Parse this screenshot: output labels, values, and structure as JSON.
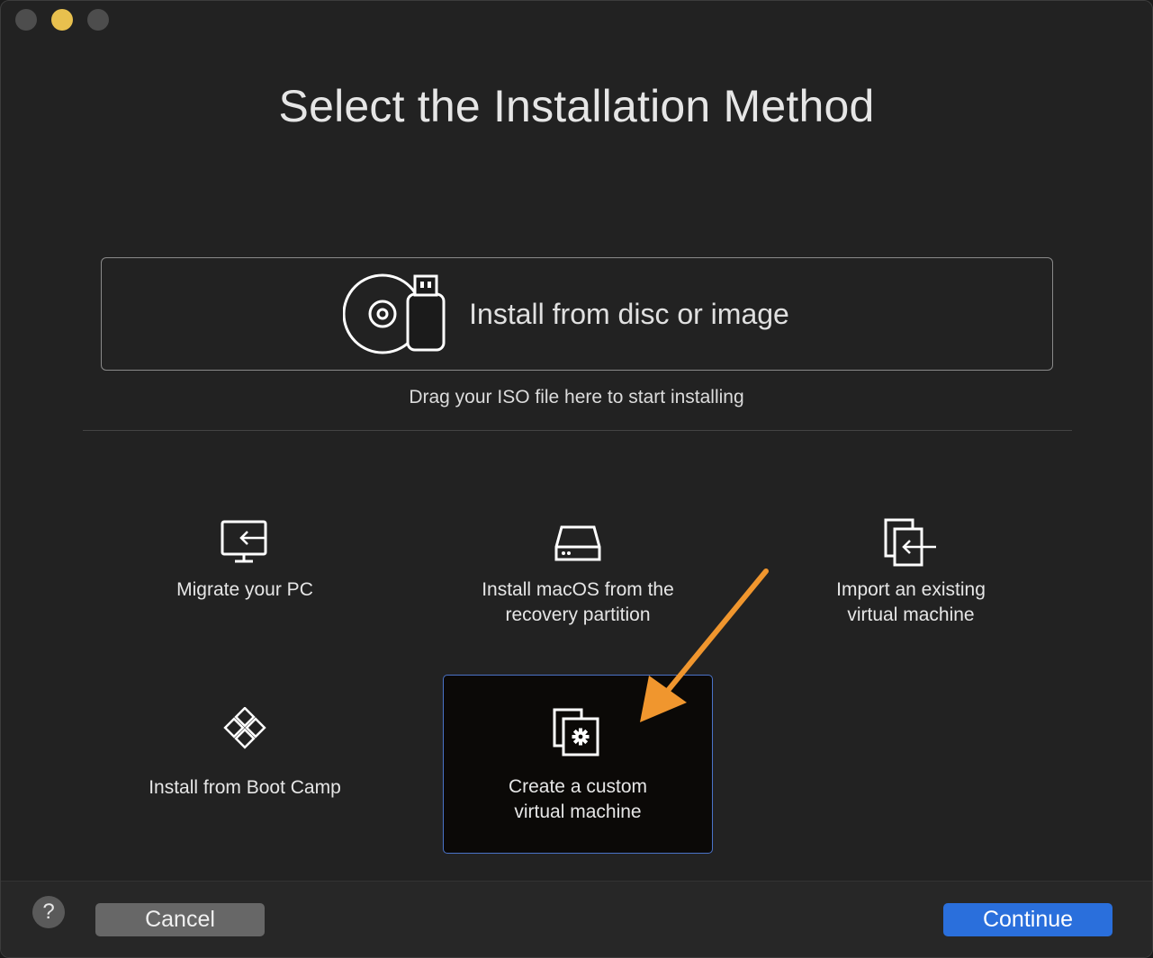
{
  "window": {
    "title": "Select the Installation Method"
  },
  "disc_option": {
    "label": "Install from disc or image",
    "icon": "disc-usb-icon",
    "hint": "Drag your ISO file here to start installing"
  },
  "options": [
    {
      "label": "Migrate your PC",
      "icon": "monitor-import-icon"
    },
    {
      "label": "Install macOS from the\nrecovery partition",
      "icon": "hard-drive-icon"
    },
    {
      "label": "Import an existing\nvirtual machine",
      "icon": "copy-import-icon"
    },
    {
      "label": "Install from Boot Camp",
      "icon": "boot-camp-icon"
    },
    {
      "label": "Create a custom\nvirtual machine",
      "icon": "custom-vm-gear-icon",
      "selected": true
    }
  ],
  "footer": {
    "help_label": "?",
    "cancel_label": "Cancel",
    "continue_label": "Continue"
  },
  "colors": {
    "accent": "#2a6fdc",
    "selection_border": "#4a73c8",
    "annotation_arrow": "#f0962e",
    "minimize_light": "#e8c04e"
  }
}
